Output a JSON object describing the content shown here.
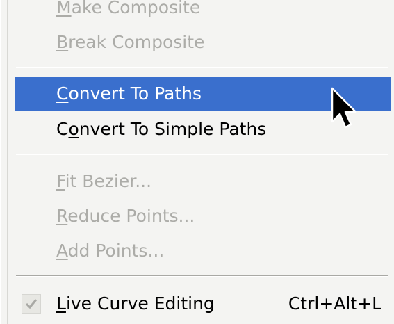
{
  "menu": {
    "items": [
      {
        "first": "M",
        "rest": "ake Composite",
        "state": "disabled"
      },
      {
        "first": "B",
        "rest": "reak Composite",
        "state": "disabled"
      },
      {
        "first": "C",
        "rest": "onvert To Paths",
        "state": "highlighted"
      },
      {
        "pre": "C",
        "mn": "o",
        "post": "nvert To Simple Paths",
        "state": "enabled"
      },
      {
        "first": "F",
        "rest": "it Bezier...",
        "state": "disabled"
      },
      {
        "first": "R",
        "rest": "educe Points...",
        "state": "disabled"
      },
      {
        "first": "A",
        "rest": "dd Points...",
        "state": "disabled"
      },
      {
        "first": "L",
        "rest": "ive Curve Editing",
        "state": "checked",
        "accelerator": "Ctrl+Alt+L"
      }
    ]
  },
  "colors": {
    "highlight": "#3a6fcd",
    "menu_bg": "#f4f4f2",
    "disabled_text": "#acaca8"
  },
  "icons": {
    "check": "check-icon",
    "cursor": "mouse-pointer-icon"
  }
}
